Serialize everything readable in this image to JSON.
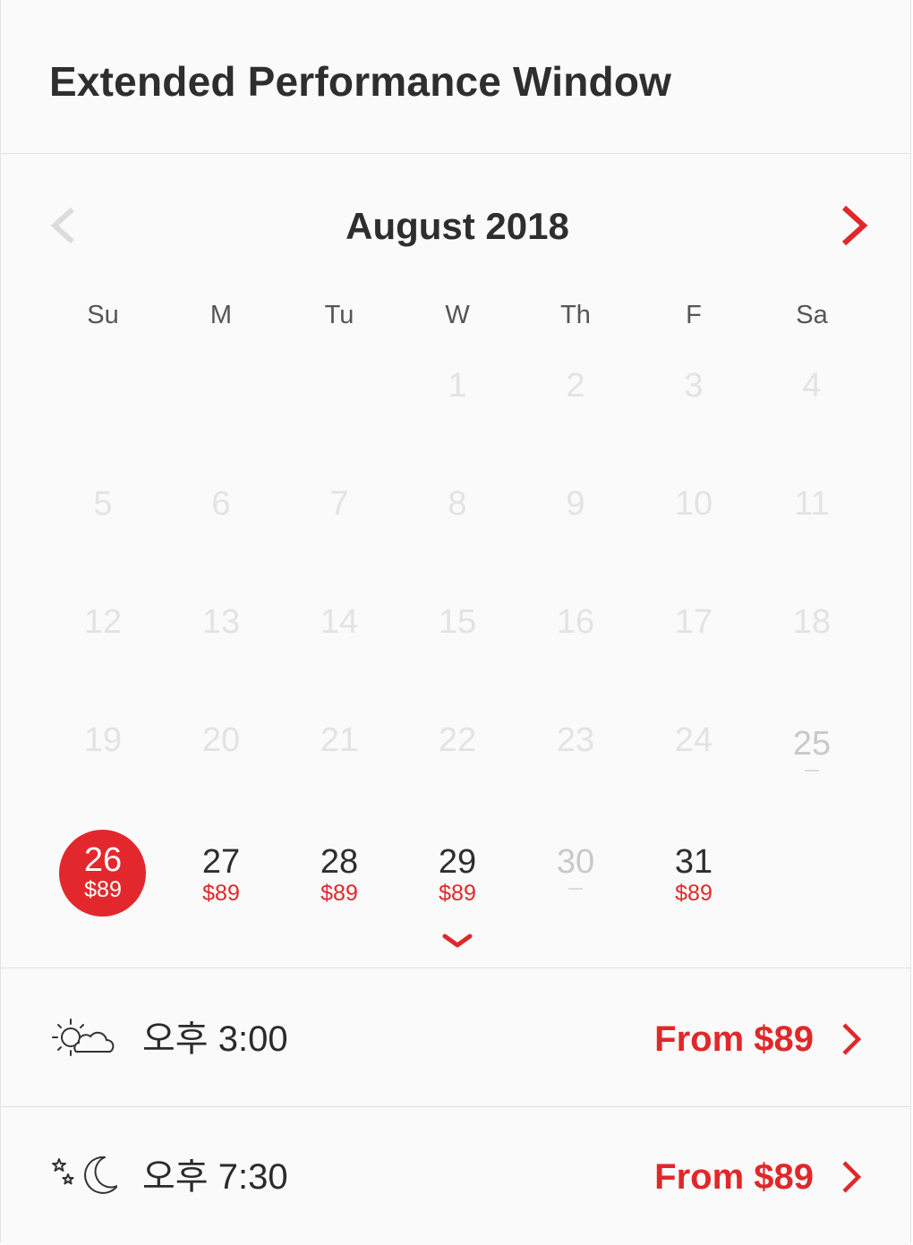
{
  "header": {
    "title": "Extended Performance Window"
  },
  "calendar": {
    "month_label": "August 2018",
    "prev_icon": "chevron-left-icon",
    "next_icon": "chevron-right-icon",
    "expand_icon": "chevron-down-icon",
    "weekdays": [
      "Su",
      "M",
      "Tu",
      "W",
      "Th",
      "F",
      "Sa"
    ],
    "weeks": [
      [
        {
          "day": "",
          "state": "empty"
        },
        {
          "day": "",
          "state": "empty"
        },
        {
          "day": "",
          "state": "empty"
        },
        {
          "day": "1",
          "state": "past"
        },
        {
          "day": "2",
          "state": "past"
        },
        {
          "day": "3",
          "state": "past"
        },
        {
          "day": "4",
          "state": "past"
        }
      ],
      [
        {
          "day": "5",
          "state": "past"
        },
        {
          "day": "6",
          "state": "past"
        },
        {
          "day": "7",
          "state": "past"
        },
        {
          "day": "8",
          "state": "past"
        },
        {
          "day": "9",
          "state": "past"
        },
        {
          "day": "10",
          "state": "past"
        },
        {
          "day": "11",
          "state": "past"
        }
      ],
      [
        {
          "day": "12",
          "state": "past"
        },
        {
          "day": "13",
          "state": "past"
        },
        {
          "day": "14",
          "state": "past"
        },
        {
          "day": "15",
          "state": "past"
        },
        {
          "day": "16",
          "state": "past"
        },
        {
          "day": "17",
          "state": "past"
        },
        {
          "day": "18",
          "state": "past"
        }
      ],
      [
        {
          "day": "19",
          "state": "past"
        },
        {
          "day": "20",
          "state": "past"
        },
        {
          "day": "21",
          "state": "past"
        },
        {
          "day": "22",
          "state": "past"
        },
        {
          "day": "23",
          "state": "past"
        },
        {
          "day": "24",
          "state": "past"
        },
        {
          "day": "25",
          "state": "sold"
        }
      ],
      [
        {
          "day": "26",
          "state": "selected",
          "price": "$89"
        },
        {
          "day": "27",
          "state": "avail",
          "price": "$89"
        },
        {
          "day": "28",
          "state": "avail",
          "price": "$89"
        },
        {
          "day": "29",
          "state": "avail",
          "price": "$89"
        },
        {
          "day": "30",
          "state": "sold"
        },
        {
          "day": "31",
          "state": "avail",
          "price": "$89"
        },
        {
          "day": "",
          "state": "empty"
        }
      ]
    ]
  },
  "showtimes": [
    {
      "time": "오후 3:00",
      "price_label": "From $89",
      "icon": "sun-cloud-icon"
    },
    {
      "time": "오후 7:30",
      "price_label": "From $89",
      "icon": "moon-stars-icon"
    }
  ],
  "colors": {
    "accent": "#e3282d",
    "text": "#2e2e2e",
    "disabled": "#e3e3e3",
    "background": "#fafafa"
  }
}
